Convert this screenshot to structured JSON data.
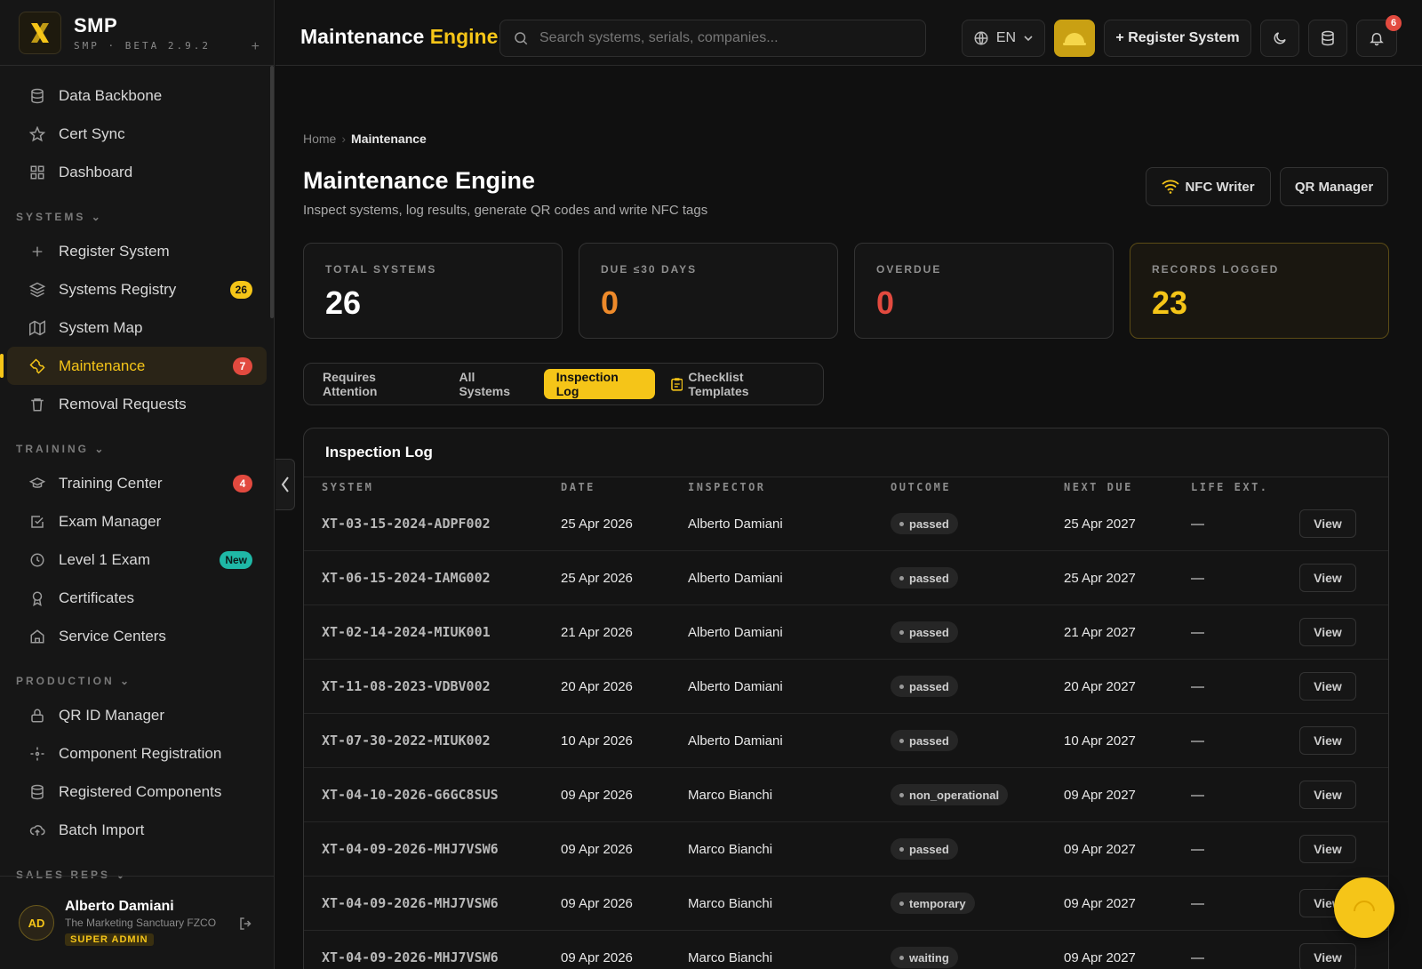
{
  "brand": {
    "name": "SMP",
    "sub": "SMP · BETA 2.9.2"
  },
  "nav_top": [
    {
      "label": "Data Backbone",
      "icon": "database-icon"
    },
    {
      "label": "Cert Sync",
      "icon": "star-icon"
    },
    {
      "label": "Dashboard",
      "icon": "grid-icon"
    }
  ],
  "sections": {
    "systems": "SYSTEMS",
    "training": "TRAINING",
    "production": "PRODUCTION",
    "sales": "SALES REPS"
  },
  "nav_systems": [
    {
      "label": "Register System",
      "icon": "plus-icon",
      "badge": ""
    },
    {
      "label": "Systems Registry",
      "icon": "layers-icon",
      "badge": "26"
    },
    {
      "label": "System Map",
      "icon": "map-icon",
      "badge": ""
    },
    {
      "label": "Maintenance",
      "icon": "wrench-icon",
      "badge": "7"
    },
    {
      "label": "Removal Requests",
      "icon": "trash-icon",
      "badge": ""
    }
  ],
  "nav_training": [
    {
      "label": "Training Center",
      "icon": "graduation-cap-icon",
      "badge": "4"
    },
    {
      "label": "Exam Manager",
      "icon": "check-square-icon",
      "badge": ""
    },
    {
      "label": "Level 1 Exam",
      "icon": "clock-icon",
      "badge": "New"
    },
    {
      "label": "Certificates",
      "icon": "award-icon",
      "badge": ""
    },
    {
      "label": "Service Centers",
      "icon": "building-icon",
      "badge": ""
    }
  ],
  "nav_production": [
    {
      "label": "QR ID Manager",
      "icon": "lock-icon"
    },
    {
      "label": "Component Registration",
      "icon": "sparkle-icon"
    },
    {
      "label": "Registered Components",
      "icon": "database-icon"
    },
    {
      "label": "Batch Import",
      "icon": "cloud-upload-icon"
    }
  ],
  "user": {
    "initials": "AD",
    "name": "Alberto Damiani",
    "company": "The Marketing Sanctuary FZCO",
    "role": "SUPER ADMIN"
  },
  "topbar": {
    "title_a": "Maintenance",
    "title_b": "Engine",
    "search_placeholder": "Search systems, serials, companies...",
    "lang": "EN",
    "register_label": "+ Register System",
    "notifications": "6"
  },
  "page": {
    "crumb_home": "Home",
    "crumb_current": "Maintenance",
    "title": "Maintenance Engine",
    "subtitle": "Inspect systems, log results, generate QR codes and write NFC tags",
    "nfc_label": "NFC Writer",
    "qr_label": "QR Manager"
  },
  "stats": [
    {
      "label": "TOTAL SYSTEMS",
      "value": "26"
    },
    {
      "label": "DUE ≤30 DAYS",
      "value": "0"
    },
    {
      "label": "OVERDUE",
      "value": "0"
    },
    {
      "label": "RECORDS LOGGED",
      "value": "23"
    }
  ],
  "tabs": [
    "Requires Attention",
    "All Systems",
    "Inspection Log",
    "Checklist Templates"
  ],
  "log": {
    "title": "Inspection Log",
    "columns": [
      "SYSTEM",
      "DATE",
      "INSPECTOR",
      "OUTCOME",
      "NEXT DUE",
      "LIFE EXT."
    ],
    "view_label": "View",
    "rows": [
      {
        "system": "XT-03-15-2024-ADPF002",
        "date": "25 Apr 2026",
        "inspector": "Alberto Damiani",
        "outcome": "passed",
        "next": "25 Apr 2027",
        "life": "—"
      },
      {
        "system": "XT-06-15-2024-IAMG002",
        "date": "25 Apr 2026",
        "inspector": "Alberto Damiani",
        "outcome": "passed",
        "next": "25 Apr 2027",
        "life": "—"
      },
      {
        "system": "XT-02-14-2024-MIUK001",
        "date": "21 Apr 2026",
        "inspector": "Alberto Damiani",
        "outcome": "passed",
        "next": "21 Apr 2027",
        "life": "—"
      },
      {
        "system": "XT-11-08-2023-VDBV002",
        "date": "20 Apr 2026",
        "inspector": "Alberto Damiani",
        "outcome": "passed",
        "next": "20 Apr 2027",
        "life": "—"
      },
      {
        "system": "XT-07-30-2022-MIUK002",
        "date": "10 Apr 2026",
        "inspector": "Alberto Damiani",
        "outcome": "passed",
        "next": "10 Apr 2027",
        "life": "—"
      },
      {
        "system": "XT-04-10-2026-G6GC8SUS",
        "date": "09 Apr 2026",
        "inspector": "Marco Bianchi",
        "outcome": "non_operational",
        "next": "09 Apr 2027",
        "life": "—"
      },
      {
        "system": "XT-04-09-2026-MHJ7VSW6",
        "date": "09 Apr 2026",
        "inspector": "Marco Bianchi",
        "outcome": "passed",
        "next": "09 Apr 2027",
        "life": "—"
      },
      {
        "system": "XT-04-09-2026-MHJ7VSW6",
        "date": "09 Apr 2026",
        "inspector": "Marco Bianchi",
        "outcome": "temporary",
        "next": "09 Apr 2027",
        "life": "—"
      },
      {
        "system": "XT-04-09-2026-MHJ7VSW6",
        "date": "09 Apr 2026",
        "inspector": "Marco Bianchi",
        "outcome": "waiting",
        "next": "09 Apr 2027",
        "life": "—"
      }
    ]
  },
  "colors": {
    "accent": "#f5c518",
    "danger": "#e24a3f",
    "warning": "#ee8a2a",
    "teal": "#1fb8a6"
  }
}
